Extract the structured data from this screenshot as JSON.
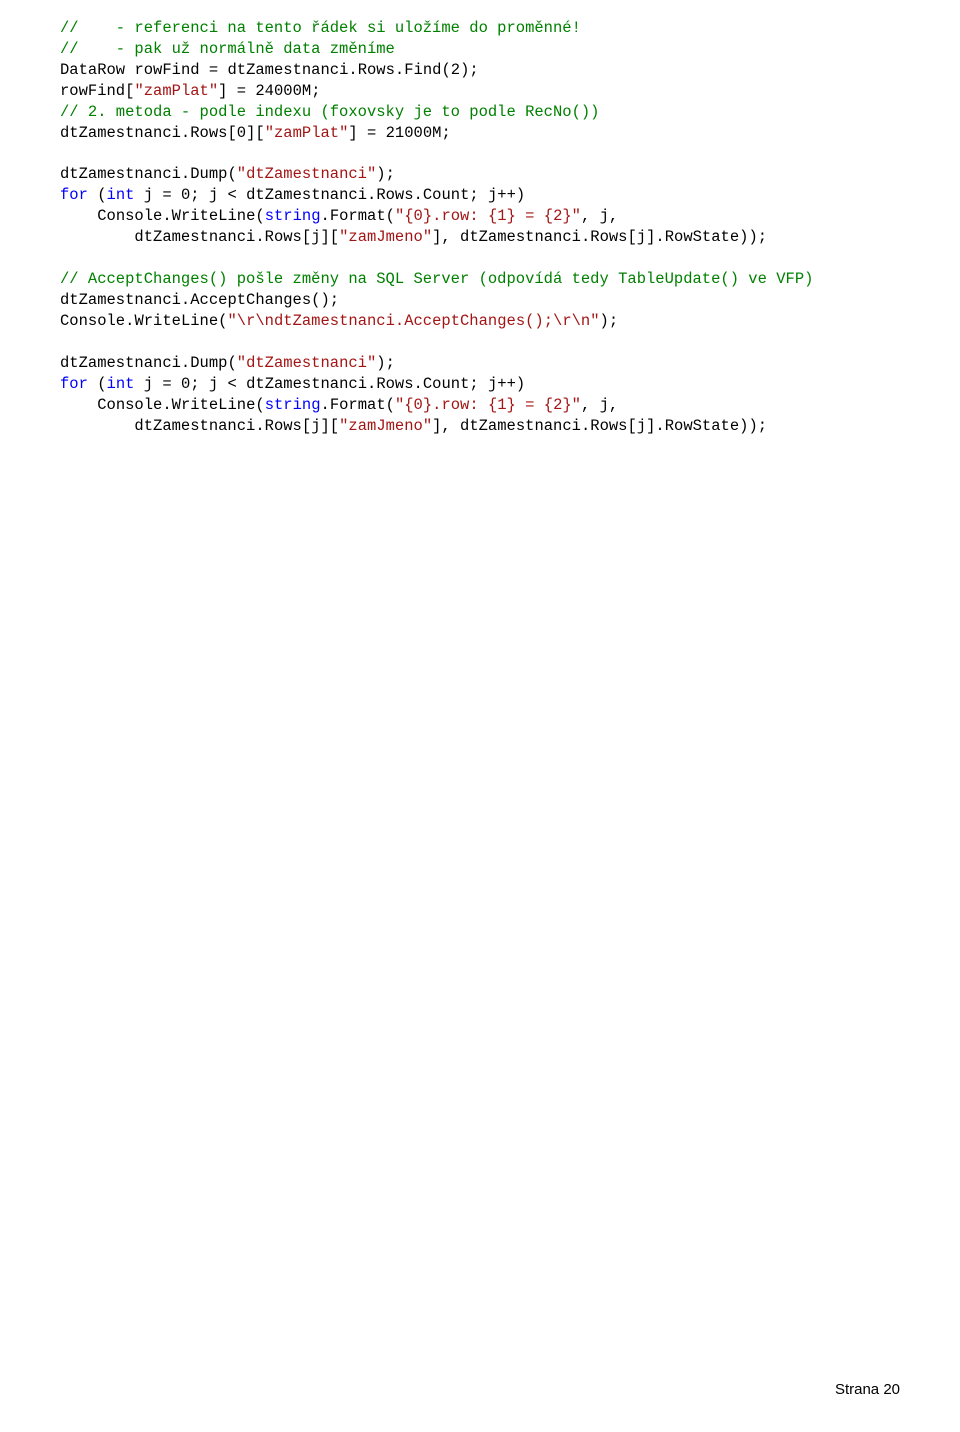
{
  "code": {
    "comments": {
      "c1": "//    - referenci na tento řádek si uložíme do proměnné!",
      "c2": "//    - pak už normálně data změníme",
      "c3": "// 2. metoda - podle indexu (foxovsky je to podle RecNo())",
      "c4": "// AcceptChanges() pošle změny na SQL Server (odpovídá tedy TableUpdate() ve VFP)"
    },
    "tokens": {
      "DataRow": "DataRow",
      "rowFind": "rowFind",
      "dtZamestnanci": "dtZamestnanci",
      "Rows": "Rows",
      "Find": "Find",
      "zamPlat": "\"zamPlat\"",
      "zamJmeno": "\"zamJmeno\"",
      "dtZamestnanciStr": "\"dtZamestnanci\"",
      "Dump": "Dump",
      "for": "for",
      "int": "int",
      "j": "j",
      "Count": "Count",
      "Console": "Console",
      "WriteLine": "WriteLine",
      "string": "string",
      "Format": "Format",
      "fmt": "\"{0}.row: {1} = {2}\"",
      "RowState": "RowState",
      "AcceptChanges": "AcceptChanges",
      "acceptStr": "\"\\r\\ndtZamestnanci.AcceptChanges();\\r\\n\""
    },
    "numbers": {
      "two": "2",
      "n24000M": "24000M",
      "n21000M": "21000M",
      "zero": "0"
    }
  },
  "footer": "Strana 20"
}
